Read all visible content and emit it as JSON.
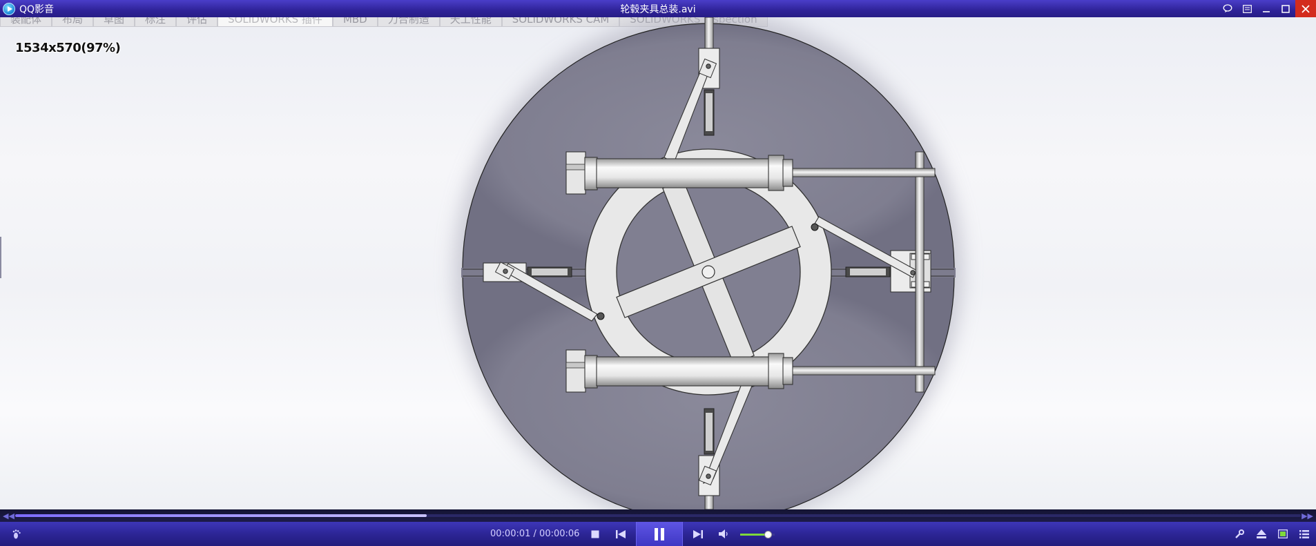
{
  "app": {
    "name": "QQ影音",
    "window_title": "轮毂夹具总装.avi"
  },
  "window_controls": [
    "chat-icon",
    "playlist-icon",
    "minimize-icon",
    "maximize-icon",
    "close-icon"
  ],
  "video": {
    "cad_tabs": [
      "装配体",
      "布局",
      "草图",
      "标注",
      "评估",
      "SOLIDWORKS 插件",
      "MBD",
      "力合制造",
      "天工性能",
      "SOLIDWORKS CAM",
      "SOLIDWORKS Inspection"
    ],
    "cad_active_tab": 5,
    "resolution_label": "1534x570(97%)"
  },
  "playback": {
    "current_time": "00:00:01",
    "total_time": "00:00:06",
    "time_separator": " / ",
    "progress": 0.32,
    "volume": 0.8,
    "state": "playing"
  },
  "icons": {
    "left_controls": [
      "footprint-icon"
    ],
    "center_controls": [
      "stop-icon",
      "previous-icon",
      "pause-icon",
      "next-icon",
      "volume-icon"
    ],
    "right_controls": [
      "settings-wrench-icon",
      "eject-icon",
      "screen-icon",
      "playlist-menu-icon"
    ]
  },
  "colors": {
    "titlebar": "#2f2398",
    "accent": "#5e55e4",
    "volume_fill": "#7fd93b",
    "close_button": "#d32c1e",
    "disc": "#818090"
  }
}
